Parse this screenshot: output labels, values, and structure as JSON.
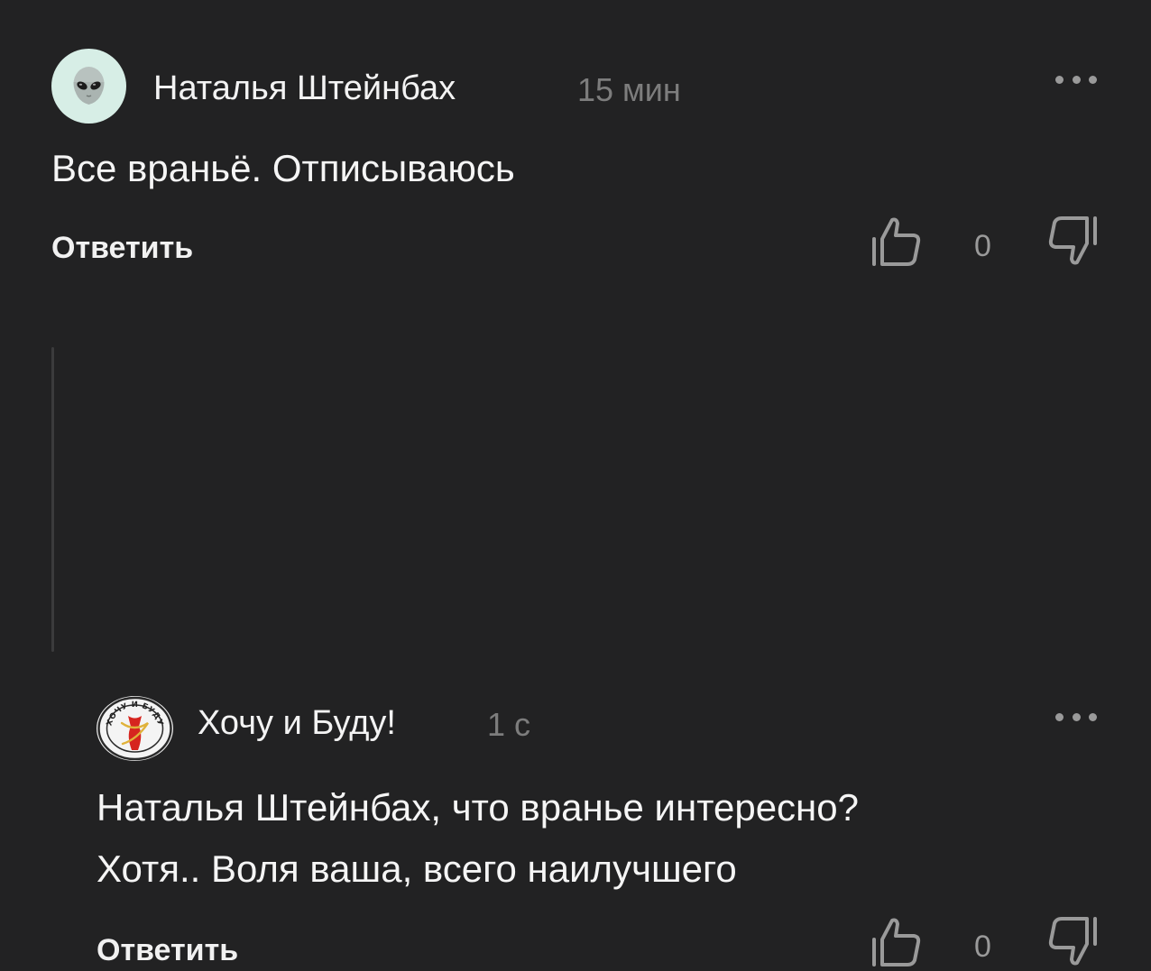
{
  "comments": [
    {
      "author": "Наталья Штейнбах",
      "time": "15 мин",
      "avatar_icon": "alien-emoji-icon",
      "text": "Все враньё. Отписываюсь",
      "reply_label": "Ответить",
      "likes": "0"
    },
    {
      "author": "Хочу и Буду!",
      "time": "1 с",
      "avatar_icon": "hochu-i-budu-logo",
      "avatar_logo_text": "ХОЧУ И БУДУ",
      "text_line1": "Наталья Штейнбах, что вранье интересно?",
      "text_line2": "Хотя.. Воля ваша, всего наилучшего",
      "reply_label": "Ответить",
      "likes": "0"
    }
  ],
  "colors": {
    "background": "#222223",
    "text": "#f5f5f5",
    "muted": "#7d7d7d",
    "icon": "#9a9a9a",
    "thread_line": "#3b3b3c",
    "logo_red": "#d6251f"
  }
}
